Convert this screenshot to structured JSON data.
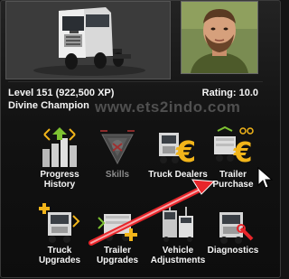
{
  "profile": {
    "level_text": "Level 151 (922,500 XP)",
    "rating_text": "Rating: 10.0",
    "title_text": "Divine Champion"
  },
  "watermark": "www.ets2indo.com",
  "tiles": [
    {
      "label": "Progress\nHistory",
      "icon": "progress-history-icon",
      "enabled": true
    },
    {
      "label": "Skills",
      "icon": "skills-icon",
      "enabled": false
    },
    {
      "label": "Truck Dealers",
      "icon": "truck-dealers-icon",
      "enabled": true
    },
    {
      "label": "Trailer\nPurchase",
      "icon": "trailer-purchase-icon",
      "enabled": true
    },
    {
      "label": "Truck\nUpgrades",
      "icon": "truck-upgrades-icon",
      "enabled": true
    },
    {
      "label": "Trailer\nUpgrades",
      "icon": "trailer-upgrades-icon",
      "enabled": true
    },
    {
      "label": "Vehicle\nAdjustments",
      "icon": "vehicle-adjustments-icon",
      "enabled": true
    },
    {
      "label": "Diagnostics",
      "icon": "diagnostics-icon",
      "enabled": true
    }
  ],
  "colors": {
    "accent_gold": "#f2b51a",
    "accent_green": "#7ec232",
    "arrow_red": "#e8252a"
  }
}
